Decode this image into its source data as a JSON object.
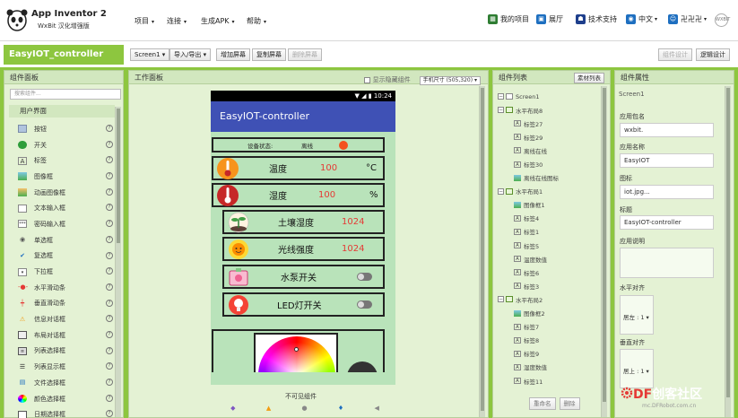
{
  "header": {
    "brand_title": "App Inventor 2",
    "brand_sub": "WxBit 汉化增强版",
    "menus": [
      "项目",
      "连接",
      "生成APK",
      "帮助"
    ],
    "links": [
      "我的项目",
      "展厅",
      "技术支持",
      "中文",
      "卍卍卍"
    ],
    "avatar_text": "WXBIT"
  },
  "project_bar": {
    "project_name": "EasyIOT_controller",
    "screen_select": "Screen1",
    "buttons": [
      "导入/导出",
      "增加屏幕",
      "复制屏幕",
      "删除屏幕"
    ],
    "right_buttons": [
      "组件设计",
      "逻辑设计"
    ]
  },
  "palette": {
    "title": "组件面板",
    "search_placeholder": "搜索组件...",
    "category": "用户界面",
    "items": [
      "按钮",
      "开关",
      "标签",
      "图像框",
      "动画图像框",
      "文本输入框",
      "密码输入框",
      "单选框",
      "复选框",
      "下拉框",
      "水平滑动条",
      "垂直滑动条",
      "信息对话框",
      "布局对话框",
      "列表选择框",
      "列表显示框",
      "文件选择框",
      "颜色选择框",
      "日期选择框"
    ]
  },
  "viewer": {
    "title": "工作面板",
    "show_hidden": "显示隐藏组件",
    "size_select": "手机尺寸 (505,320)",
    "phone": {
      "time": "10:24",
      "app_title": "EasyIOT-controller",
      "status_label": "设备状态:",
      "status_value": "离线",
      "sensors": [
        {
          "name": "温度",
          "value": "100",
          "unit": "°C"
        },
        {
          "name": "湿度",
          "value": "100",
          "unit": "%"
        },
        {
          "name": "土壤湿度",
          "value": "1024",
          "unit": ""
        },
        {
          "name": "光线强度",
          "value": "1024",
          "unit": ""
        }
      ],
      "switches": [
        "水泵开关",
        "LED灯开关"
      ]
    },
    "non_visible_label": "不可见组件"
  },
  "tree": {
    "title": "组件列表",
    "media_button": "素材列表",
    "items": [
      {
        "label": "Screen1",
        "indent": 0,
        "toggle": "⊟"
      },
      {
        "label": "水平布局8",
        "indent": 1,
        "toggle": "⊟"
      },
      {
        "label": "标签27",
        "indent": 2,
        "toggle": ""
      },
      {
        "label": "标签29",
        "indent": 2,
        "toggle": ""
      },
      {
        "label": "离线在线",
        "indent": 2,
        "toggle": ""
      },
      {
        "label": "标签30",
        "indent": 2,
        "toggle": ""
      },
      {
        "label": "离线在线图标",
        "indent": 2,
        "toggle": ""
      },
      {
        "label": "水平布局1",
        "indent": 1,
        "toggle": "⊟"
      },
      {
        "label": "图像框1",
        "indent": 2,
        "toggle": ""
      },
      {
        "label": "标签4",
        "indent": 2,
        "toggle": ""
      },
      {
        "label": "标签1",
        "indent": 2,
        "toggle": ""
      },
      {
        "label": "标签5",
        "indent": 2,
        "toggle": ""
      },
      {
        "label": "温度数值",
        "indent": 2,
        "toggle": ""
      },
      {
        "label": "标签6",
        "indent": 2,
        "toggle": ""
      },
      {
        "label": "标签3",
        "indent": 2,
        "toggle": ""
      },
      {
        "label": "水平布局2",
        "indent": 1,
        "toggle": "⊟"
      },
      {
        "label": "图像框2",
        "indent": 2,
        "toggle": ""
      },
      {
        "label": "标签7",
        "indent": 2,
        "toggle": ""
      },
      {
        "label": "标签8",
        "indent": 2,
        "toggle": ""
      },
      {
        "label": "标签9",
        "indent": 2,
        "toggle": ""
      },
      {
        "label": "湿度数值",
        "indent": 2,
        "toggle": ""
      },
      {
        "label": "标签11",
        "indent": 2,
        "toggle": ""
      }
    ],
    "buttons": [
      "重命名",
      "删除"
    ]
  },
  "props": {
    "title": "组件属性",
    "component": "Screen1",
    "fields": [
      {
        "label": "应用包名",
        "value": "wxbit."
      },
      {
        "label": "应用名称",
        "value": "EasyIOT"
      },
      {
        "label": "图标",
        "value": "iot.jpg..."
      },
      {
        "label": "标题",
        "value": "EasyIOT-controller"
      }
    ],
    "desc_label": "应用说明",
    "halign_label": "水平对齐",
    "halign_value": "居左 : 1 ▾",
    "valign_label": "垂直对齐",
    "valign_value": "居上 : 1 ▾"
  },
  "watermark": {
    "main_prefix": "DF",
    "main_text": "创客社区",
    "url": "mc.DFRobot.com.cn"
  }
}
